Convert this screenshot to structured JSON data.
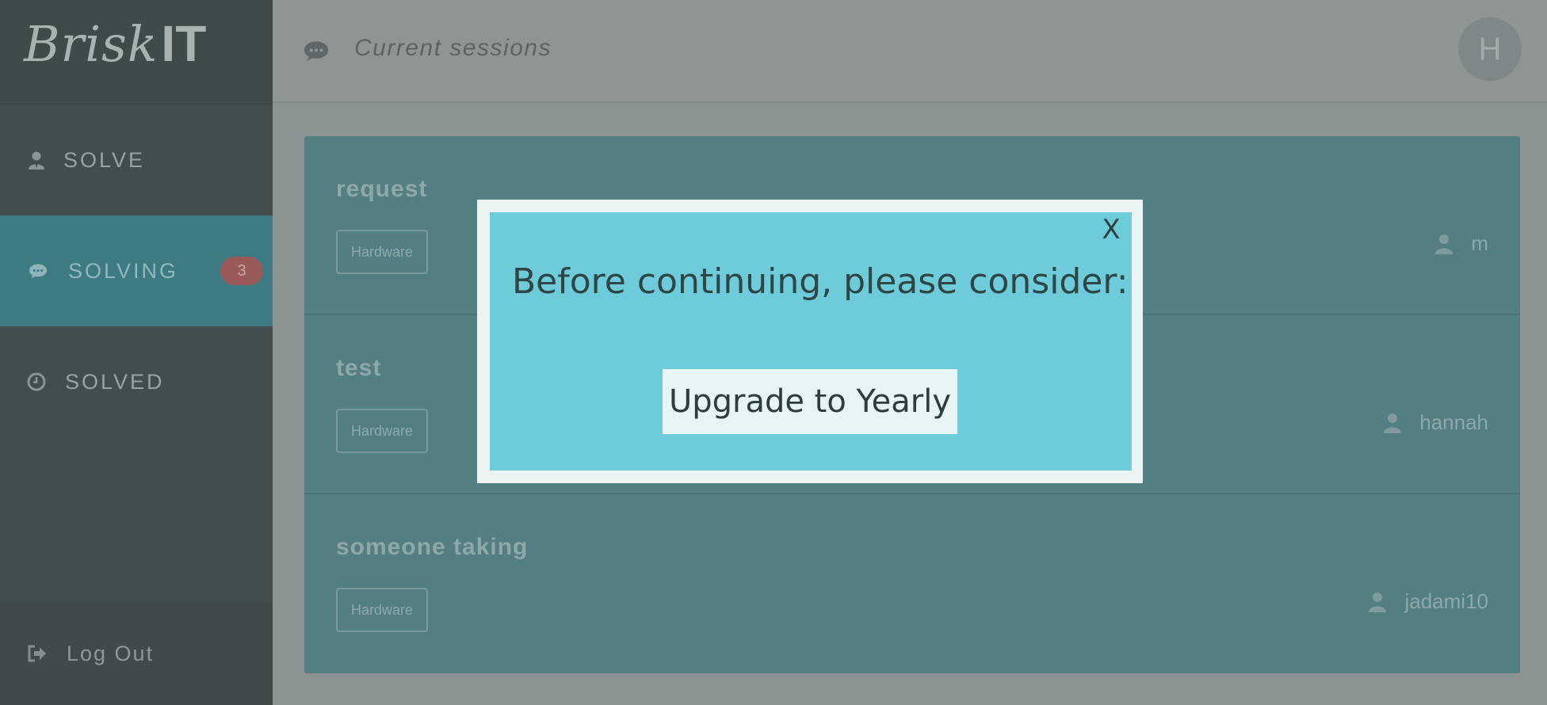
{
  "app": {
    "logo_left": "Brisk",
    "logo_right": "IT"
  },
  "sidebar": {
    "items": [
      {
        "label": "SOLVE",
        "icon": "user-tie-icon",
        "active": false
      },
      {
        "label": "SOLVING",
        "icon": "chat-icon",
        "active": true,
        "badge": "3"
      },
      {
        "label": "SOLVED",
        "icon": "clock-icon",
        "active": false
      }
    ],
    "logout_label": "Log Out"
  },
  "header": {
    "title": "Current sessions",
    "avatar_initial": "H"
  },
  "sessions": [
    {
      "title": "request",
      "tag": "Hardware",
      "user": "m"
    },
    {
      "title": "test",
      "tag": "Hardware",
      "user": "hannah"
    },
    {
      "title": "someone taking",
      "tag": "Hardware",
      "user": "jadami10"
    }
  ],
  "modal": {
    "close_label": "X",
    "heading": "Before continuing, please consider:",
    "button_label": "Upgrade to Yearly"
  },
  "colors": {
    "sidebar": "#424d4d",
    "active_nav": "#3d7a82",
    "panel": "#537f82",
    "modal": "#6ecbd9",
    "badge": "#9a5a5a"
  }
}
